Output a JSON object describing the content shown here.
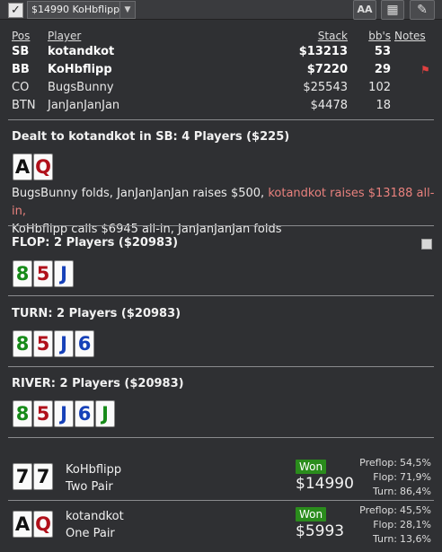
{
  "toolbar": {
    "checkbox_mark": "✓",
    "combo_value": "$14990 KoHbflipp",
    "combo_arrow": "▼",
    "font_button": "AA",
    "grid_button": "▦",
    "edit_button": "✎"
  },
  "players": {
    "headers": {
      "pos": "Pos",
      "player": "Player",
      "stack": "Stack",
      "bbs": "bb's",
      "notes": "Notes"
    },
    "rows": [
      {
        "pos": "SB",
        "name": "kotandkot",
        "stack": "$13213",
        "bbs": "53",
        "bold": true
      },
      {
        "pos": "BB",
        "name": "KoHbflipp",
        "stack": "$7220",
        "bbs": "29",
        "bold": true,
        "flag": "⚑"
      },
      {
        "pos": "CO",
        "name": "BugsBunny",
        "stack": "$25543",
        "bbs": "102",
        "bold": false
      },
      {
        "pos": "BTN",
        "name": "JanJanJanJan",
        "stack": "$4478",
        "bbs": "18",
        "bold": false
      }
    ]
  },
  "preflop": {
    "title": "Dealt to kotandkot in SB: 4 Players ($225)",
    "cards": [
      {
        "rank": "A",
        "suit": "s"
      },
      {
        "rank": "Q",
        "suit": "h"
      }
    ],
    "actions_part1": "BugsBunny folds, JanJanJanJan raises $500, ",
    "actions_hero": "kotandkot raises $13188 all-in,",
    "actions_part2": "KoHbflipp calls $6945 all-in, JanJanJanJan folds"
  },
  "flop": {
    "title": "FLOP: 2 Players ($20983)",
    "cards": [
      {
        "rank": "8",
        "suit": "c"
      },
      {
        "rank": "5",
        "suit": "h"
      },
      {
        "rank": "J",
        "suit": "d"
      }
    ]
  },
  "turn": {
    "title": "TURN: 2 Players ($20983)",
    "cards": [
      {
        "rank": "8",
        "suit": "c"
      },
      {
        "rank": "5",
        "suit": "h"
      },
      {
        "rank": "J",
        "suit": "d"
      },
      {
        "rank": "6",
        "suit": "d"
      }
    ]
  },
  "river": {
    "title": "RIVER: 2 Players ($20983)",
    "cards": [
      {
        "rank": "8",
        "suit": "c"
      },
      {
        "rank": "5",
        "suit": "h"
      },
      {
        "rank": "J",
        "suit": "d"
      },
      {
        "rank": "6",
        "suit": "d"
      },
      {
        "rank": "J",
        "suit": "c"
      }
    ]
  },
  "results": [
    {
      "name": "KoHbflipp",
      "hand": "Two Pair",
      "won_label": "Won",
      "amount": "$14990",
      "cards": [
        {
          "rank": "7",
          "suit": "s"
        },
        {
          "rank": "7",
          "suit": "s"
        }
      ],
      "equity": [
        {
          "label": "Preflop:",
          "value": "54,5%"
        },
        {
          "label": "Flop:",
          "value": "71,9%"
        },
        {
          "label": "Turn:",
          "value": "86,4%"
        }
      ]
    },
    {
      "name": "kotandkot",
      "hand": "One Pair",
      "won_label": "Won",
      "amount": "$5993",
      "cards": [
        {
          "rank": "A",
          "suit": "s"
        },
        {
          "rank": "Q",
          "suit": "h"
        }
      ],
      "equity": [
        {
          "label": "Preflop:",
          "value": "45,5%"
        },
        {
          "label": "Flop:",
          "value": "28,1%"
        },
        {
          "label": "Turn:",
          "value": "13,6%"
        }
      ]
    }
  ]
}
